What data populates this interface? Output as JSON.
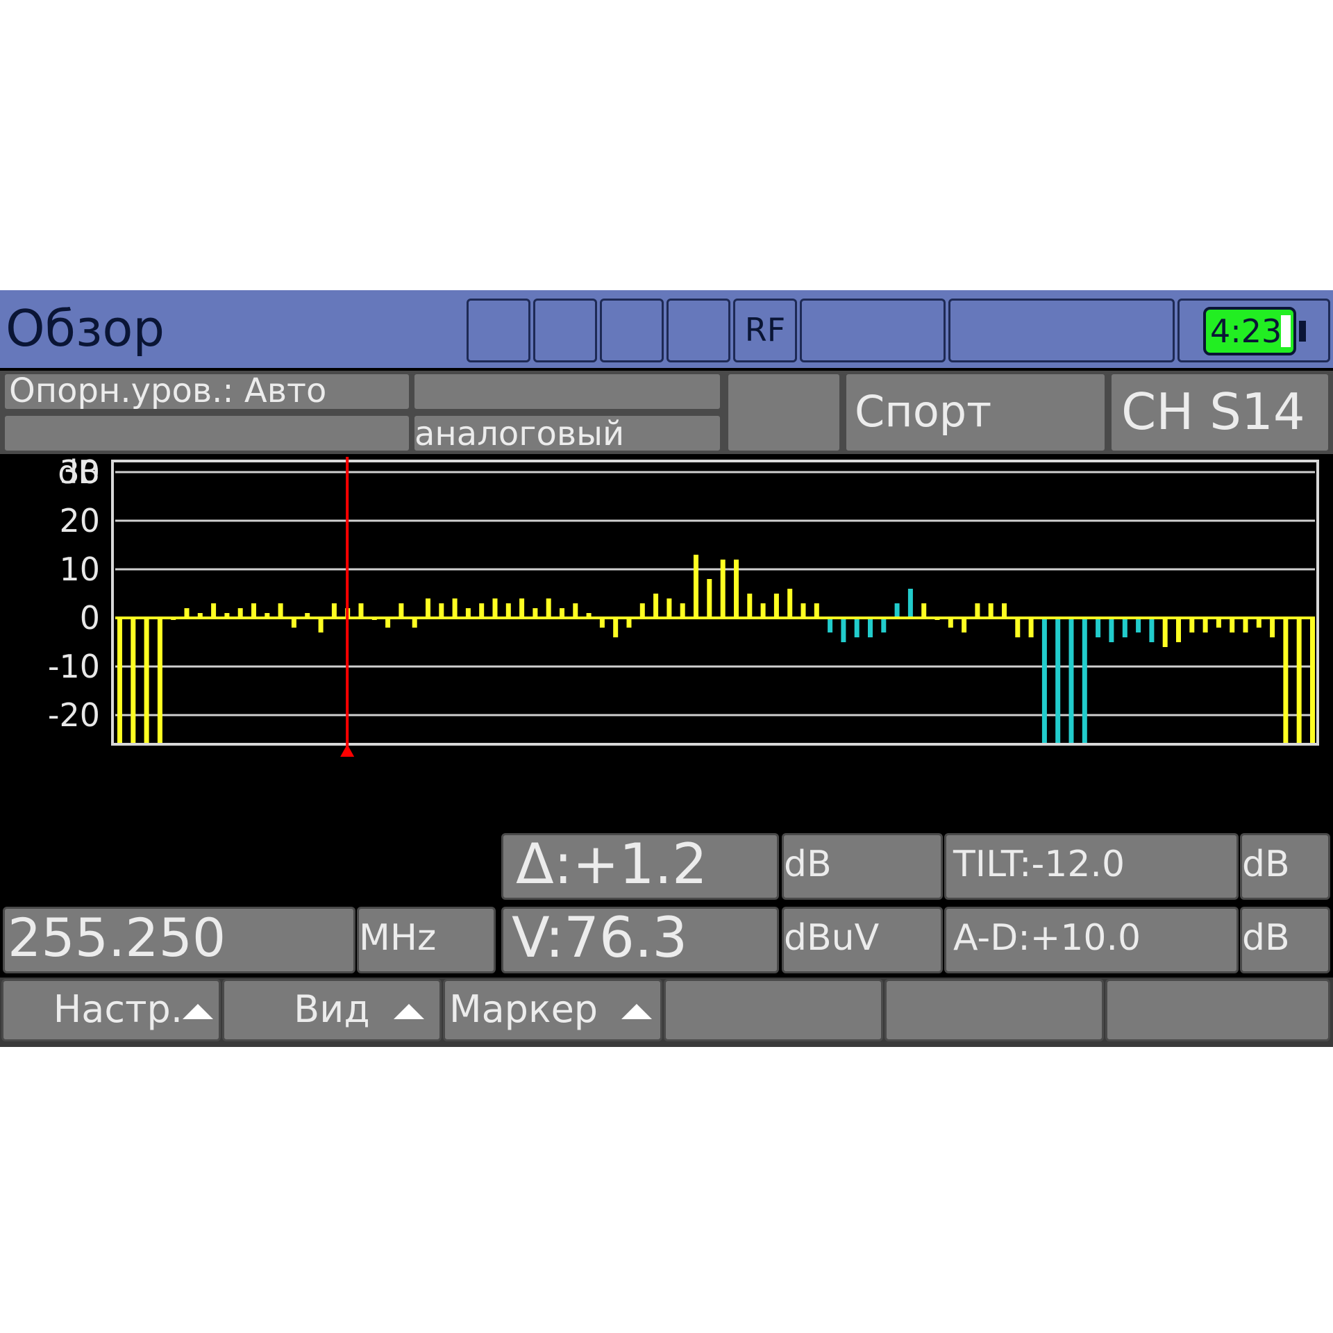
{
  "header": {
    "title": "Обзор",
    "rf_label": "RF",
    "battery_time": "4:23"
  },
  "info": {
    "ref_level": "Опорн.уров.: Авто",
    "mode": "аналоговый",
    "channel_name": "Спорт",
    "channel_id": "CH S14"
  },
  "readouts": {
    "delta": "Δ:+1.2",
    "delta_unit": "dB",
    "tilt": "TILT:-12.0",
    "tilt_unit": "dB",
    "frequency": "255.250",
    "frequency_unit": "MHz",
    "voltage": "V:76.3",
    "voltage_unit": "dBuV",
    "ad": "A-D:+10.0",
    "ad_unit": "dB"
  },
  "softkeys": [
    "Настр.",
    "Вид",
    "Маркер",
    "",
    "",
    ""
  ],
  "colors": {
    "header": "#6678bb",
    "bar_normal": "#ffff22",
    "bar_low": "#22cccc",
    "marker": "#ff0000",
    "battery": "#22ee22"
  },
  "chart_data": {
    "type": "bar",
    "ylabel": "dB",
    "y_ticks": [
      "30",
      "20",
      "10",
      "0",
      "-10",
      "-20"
    ],
    "ylim": [
      -30,
      35
    ],
    "grid": true,
    "marker_index": 17,
    "values": [
      -29,
      -29,
      -29,
      -29,
      0,
      2,
      1,
      3,
      1,
      2,
      3,
      1,
      3,
      -2,
      1,
      -3,
      3,
      2,
      3,
      0,
      -2,
      3,
      -2,
      4,
      3,
      4,
      2,
      3,
      4,
      3,
      4,
      2,
      4,
      2,
      3,
      1,
      -2,
      -4,
      -2,
      3,
      5,
      4,
      3,
      13,
      8,
      12,
      12,
      5,
      3,
      5,
      6,
      3,
      3,
      -3,
      -5,
      -4,
      -4,
      -3,
      3,
      6,
      3,
      0,
      -2,
      -3,
      3,
      3,
      3,
      -4,
      -4,
      -29,
      -29,
      -29,
      -29,
      -4,
      -5,
      -4,
      -3,
      -5,
      -6,
      -5,
      -3,
      -3,
      -2,
      -3,
      -3,
      -2,
      -4,
      -29,
      -29,
      -29
    ],
    "low_series_indices": [
      53,
      54,
      55,
      56,
      57,
      58,
      59,
      69,
      70,
      71,
      72,
      73,
      74,
      75,
      76,
      77
    ]
  }
}
